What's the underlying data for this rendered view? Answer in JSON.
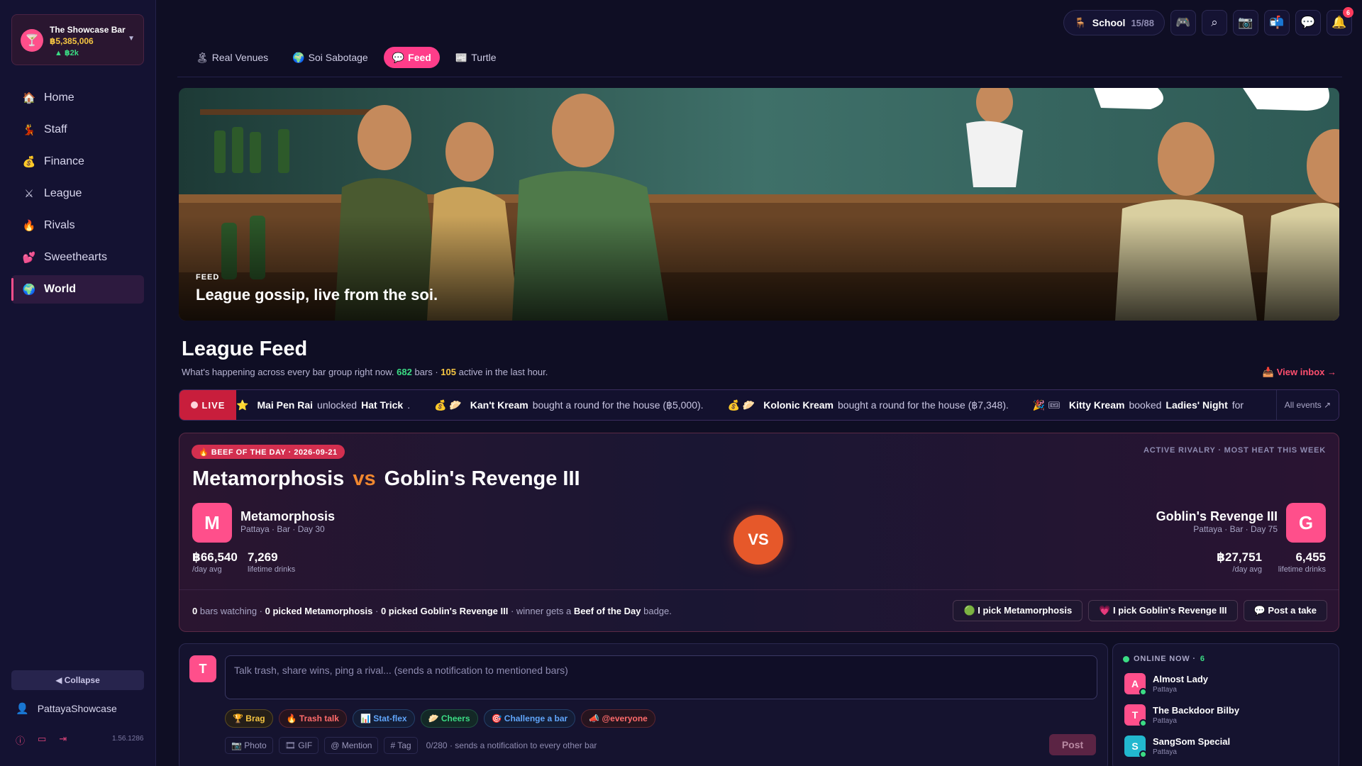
{
  "sidebar": {
    "bar": {
      "name": "The Showcase Bar",
      "cash": "฿5,385,006",
      "delta": "▲ ฿2k",
      "logo_icon": "🍸"
    },
    "nav": [
      {
        "label": "Home",
        "icon": "🏠"
      },
      {
        "label": "Staff",
        "icon": "💃"
      },
      {
        "label": "Finance",
        "icon": "💰"
      },
      {
        "label": "League",
        "icon": "⚔"
      },
      {
        "label": "Rivals",
        "icon": "🔥"
      },
      {
        "label": "Sweethearts",
        "icon": "💕"
      },
      {
        "label": "World",
        "icon": "🌍",
        "active": true
      }
    ],
    "collapse_label": "◀ Collapse",
    "username": "PattayaShowcase",
    "version": "1.56.1286"
  },
  "topbar": {
    "school_label": "School",
    "school_count": "15/88",
    "school_icon": "🪑",
    "notif_count": "6"
  },
  "tabs": [
    {
      "label": "Real Venues",
      "icon": "🏝"
    },
    {
      "label": "Soi Sabotage",
      "icon": "🌍"
    },
    {
      "label": "Feed",
      "icon": "💬",
      "active": true
    },
    {
      "label": "Turtle",
      "icon": "📰"
    }
  ],
  "hero": {
    "kicker": "FEED",
    "title": "League gossip, live from the soi."
  },
  "feed": {
    "title": "League Feed",
    "subtitle_pre": "What's happening across every bar group right now.",
    "bars_count": "682",
    "bars_word": "bars ·",
    "active_count": "105",
    "active_suffix": "active in the last hour.",
    "view_inbox": "📥 View inbox →"
  },
  "ticker": {
    "live_label": "LIVE",
    "all_events": "All events ↗",
    "items": [
      {
        "icon": "⭐",
        "actor": "Mai Pen Rai",
        "verb": "unlocked",
        "object": "Hat Trick",
        "tail": "."
      },
      {
        "icon": "💰 🥟",
        "actor": "Kan't Kream",
        "verb": "bought a round for the house (฿5,000).",
        "object": "",
        "tail": ""
      },
      {
        "icon": "💰 🥟",
        "actor": "Kolonic Kream",
        "verb": "bought a round for the house (฿7,348).",
        "object": "",
        "tail": ""
      },
      {
        "icon": "🎉 🎟",
        "actor": "Kitty Kream",
        "verb": "booked",
        "object": "Ladies' Night",
        "tail": "for"
      }
    ]
  },
  "beef": {
    "badge": "🔥 BEEF OF THE DAY · 2026-09-21",
    "right_label": "ACTIVE RIVALRY · MOST HEAT THIS WEEK",
    "title_left": "Metamorphosis",
    "title_vs": "vs",
    "title_right": "Goblin's Revenge III",
    "vs_circle": "VS",
    "left": {
      "initial": "M",
      "name": "Metamorphosis",
      "meta": "Pattaya · Bar · Day 30",
      "daily": "฿66,540",
      "daily_label": "/day avg",
      "drinks": "7,269",
      "drinks_label": "lifetime drinks"
    },
    "right": {
      "initial": "G",
      "name": "Goblin's Revenge III",
      "meta": "Pattaya · Bar · Day 75",
      "daily": "฿27,751",
      "daily_label": "/day avg",
      "drinks": "6,455",
      "drinks_label": "lifetime drinks"
    },
    "footer": {
      "watching_n": "0",
      "watching_t": "bars watching ·",
      "picked_left": "0 picked Metamorphosis",
      "sep1": "·",
      "picked_right": "0 picked Goblin's Revenge III",
      "sep2": "· winner gets a",
      "badge_name": "Beef of the Day",
      "badge_tail": "badge."
    },
    "actions": [
      {
        "label": "🟢 I pick Metamorphosis"
      },
      {
        "label": "💗 I pick Goblin's Revenge III"
      },
      {
        "label": "💬 Post a take"
      }
    ]
  },
  "composer": {
    "avatar_initial": "T",
    "placeholder": "Talk trash, share wins, ping a rival... (sends a notification to mentioned bars)",
    "chips": [
      {
        "label": "🏆 Brag",
        "kind": "brag"
      },
      {
        "label": "🔥 Trash talk",
        "kind": "trash"
      },
      {
        "label": "📊 Stat-flex",
        "kind": "stat"
      },
      {
        "label": "🥟 Cheers",
        "kind": "cheers"
      },
      {
        "label": "🎯 Challenge a bar",
        "kind": "chal"
      },
      {
        "label": "📣 @everyone",
        "kind": "every"
      }
    ],
    "tools": [
      "📷 Photo",
      "🎞 GIF",
      "@ Mention",
      "# Tag"
    ],
    "char_count": "0/280 · sends a notification to every other bar",
    "post_label": "Post"
  },
  "online": {
    "title": "ONLINE NOW ·",
    "count": "6",
    "users": [
      {
        "initial": "A",
        "name": "Almost Lady",
        "city": "Pattaya",
        "color": "#ff4f8b"
      },
      {
        "initial": "T",
        "name": "The Backdoor Bilby",
        "city": "Pattaya",
        "color": "#ff4f8b"
      },
      {
        "initial": "S",
        "name": "SangSom Special",
        "city": "Pattaya",
        "color": "#22b8cf"
      }
    ]
  },
  "colors": {
    "accent": "#ff3d8a",
    "live": "#c81e3c",
    "vs": "#e6582a",
    "positive": "#3bdc84",
    "gold": "#f5c542"
  }
}
